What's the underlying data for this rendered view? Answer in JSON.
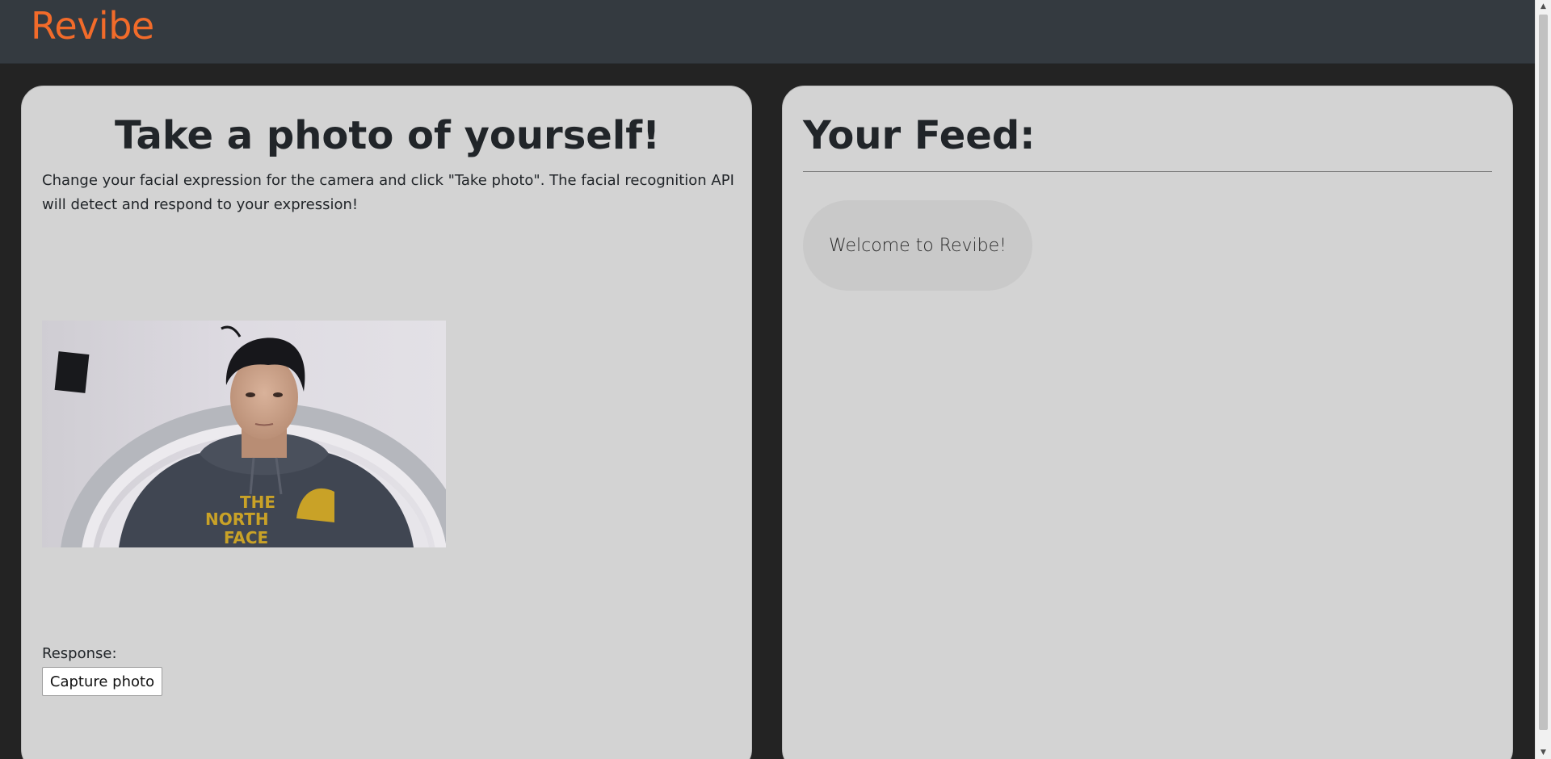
{
  "navbar": {
    "brand": "Revibe",
    "brand_color": "#f26b2a"
  },
  "left_panel": {
    "title": "Take a photo of yourself!",
    "instructions": "Change your facial expression for the camera and click \"Take photo\". The facial recognition API will detect and respond to your expression!",
    "photo": {
      "hoodie_text_line1": "THE",
      "hoodie_text_line2": "NORTH",
      "hoodie_text_line3": "FACE"
    },
    "response_label": "Response:",
    "capture_button_label": "Capture photo"
  },
  "right_panel": {
    "title": "Your Feed:",
    "feed_items": [
      {
        "text": "Welcome to Revibe!"
      }
    ]
  },
  "scrollbar": {
    "up_icon": "chevron-up-icon",
    "down_icon": "chevron-down-icon"
  }
}
